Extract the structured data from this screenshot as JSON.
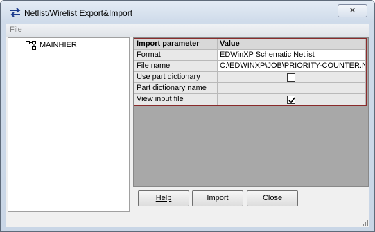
{
  "window": {
    "title": "Netlist/Wirelist Export&Import",
    "close_glyph": "✕"
  },
  "menu": {
    "file_label": "File"
  },
  "tree": {
    "root_label": "MAINHIER"
  },
  "grid": {
    "headers": [
      "Import parameter",
      "Value"
    ],
    "rows": [
      {
        "param": "Format",
        "value": "EDWinXP Schematic Netlist"
      },
      {
        "param": "File name",
        "value": "C:\\EDWINXP\\JOB\\PRIORITY-COUNTER.NET"
      },
      {
        "param": "Use part dictionary",
        "checked": false
      },
      {
        "param": "Part dictionary name",
        "value": ""
      },
      {
        "param": "View input file",
        "checked": true
      }
    ]
  },
  "buttons": {
    "help": "Help",
    "import": "Import",
    "close": "Close"
  }
}
